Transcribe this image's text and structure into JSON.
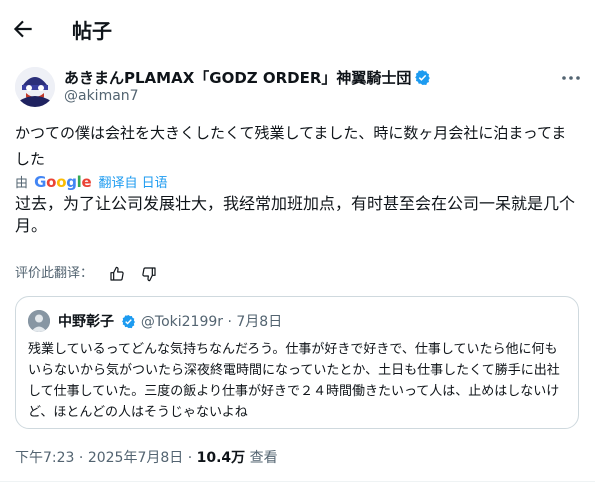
{
  "header": {
    "title": "帖子"
  },
  "post": {
    "display_name": "あきまんPLAMAX「GODZ ORDER」神翼騎士団",
    "handle": "@akiman7",
    "text": "かつての僕は会社を大きくしたくて残業してました、時に数ヶ月会社に泊まってました",
    "translated_by_prefix": "由",
    "translated_by_brand": "Google",
    "translated_from": "翻译自 日语",
    "translation": "过去，为了让公司发展壮大，我经常加班加点，有时甚至会在公司一呆就是几个月。",
    "rate_label": "评价此翻译："
  },
  "quote": {
    "name": "中野彰子",
    "handle": "@Toki2199r",
    "separator": "·",
    "date": "7月8日",
    "text": "残業しているってどんな気持ちなんだろう。仕事が好きで好きで、仕事していたら他に何もいらないから気がついたら深夜終電時間になっていたとか、土日も仕事したくて勝手に出社して仕事していた。三度の飯より仕事が好きで２４時間働きたいって人は、止めはしないけど、ほとんどの人はそうじゃないよね"
  },
  "footer": {
    "time": "下午7:23",
    "sep1": "·",
    "date": "2025年7月8日",
    "sep2": "·",
    "views": "10.4万",
    "views_label": "查看"
  },
  "colors": {
    "accent": "#1d9bf0",
    "muted": "#536471",
    "text": "#0f1419",
    "border": "#cfd9de"
  },
  "icons": {
    "back": "arrow-left-icon",
    "verified": "verified-badge-icon",
    "more": "more-dots-icon",
    "like": "thumbs-up-icon",
    "dislike": "thumbs-down-icon"
  }
}
